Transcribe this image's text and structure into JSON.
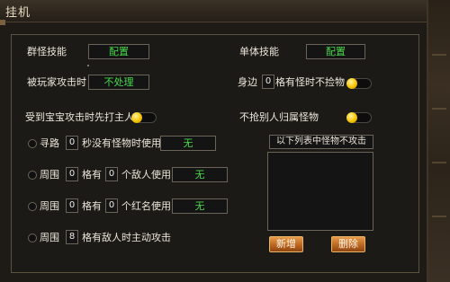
{
  "window": {
    "title": "挂机"
  },
  "left": {
    "group_skill_label": "群怪技能",
    "group_skill_btn": "配置",
    "attacked_label": "被玩家攻击时",
    "attacked_btn": "不处理",
    "pet_attack_label": "受到宝宝攻击时先打主人",
    "pet_attack_toggle": true,
    "path_label": "寻路",
    "path_value": "0",
    "path_suffix": "秒没有怪物时使用",
    "path_btn": "无",
    "area1_label": "周围",
    "area1_value": "0",
    "area1_mid": "格有",
    "area1_count": "0",
    "area1_suffix": "个敌人使用",
    "area1_btn": "无",
    "area2_label": "周围",
    "area2_value": "0",
    "area2_mid": "格有",
    "area2_count": "0",
    "area2_suffix": "个红名使用",
    "area2_btn": "无",
    "area3_label": "周围",
    "area3_value": "8",
    "area3_suffix": "格有敌人时主动攻击"
  },
  "right": {
    "single_skill_label": "单体技能",
    "single_skill_btn": "配置",
    "side_label": "身边",
    "side_value": "0",
    "side_suffix": "格有怪时不捡物",
    "side_toggle": true,
    "no_grab_label": "不抢别人归属怪物",
    "no_grab_toggle": true,
    "list_header": "以下列表中怪物不攻击",
    "list_items": [],
    "add_btn": "新增",
    "delete_btn": "删除"
  },
  "colors": {
    "green_text": "#48d94a",
    "toggle_on": "#f5c400",
    "button_orange": "#d27a30"
  }
}
